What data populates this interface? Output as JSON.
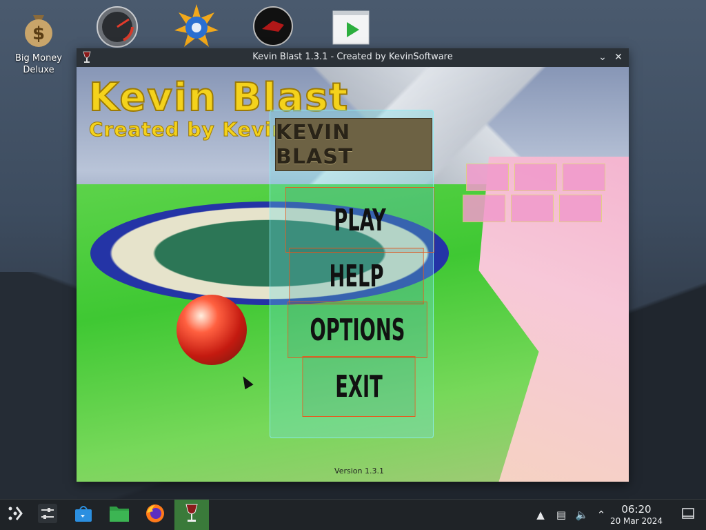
{
  "desktop": {
    "icons": [
      {
        "label": "Big Money\nDeluxe",
        "icon": "money-bag-icon"
      },
      {
        "label": "",
        "icon": "speedometer-icon"
      },
      {
        "label": "",
        "icon": "sun-game-icon"
      },
      {
        "label": "",
        "icon": "red-vehicle-icon"
      },
      {
        "label": "",
        "icon": "video-player-icon"
      }
    ]
  },
  "window": {
    "title": "Kevin Blast 1.3.1 - Created by KevinSoftware"
  },
  "game": {
    "logo_title": "Kevin Blast",
    "logo_subtitle": "Created by Kevin",
    "menu_title": "KEVIN BLAST",
    "menu": {
      "play": "PLAY",
      "help": "HELP",
      "options": "OPTIONS",
      "exit": "EXIT"
    },
    "version": "Version 1.3.1"
  },
  "taskbar": {
    "apps": [
      "app-launcher-icon",
      "settings-sliders-icon",
      "software-store-icon",
      "file-manager-icon",
      "firefox-icon",
      "wine-glass-icon"
    ],
    "time": "06:20",
    "date": "20 Mar 2024"
  },
  "colors": {
    "taskbar_active": "#3a7a3a",
    "menu_border": "#e85a20",
    "panel_cyan": "#8cf0f5",
    "logo_yellow": "#f4d21c"
  }
}
